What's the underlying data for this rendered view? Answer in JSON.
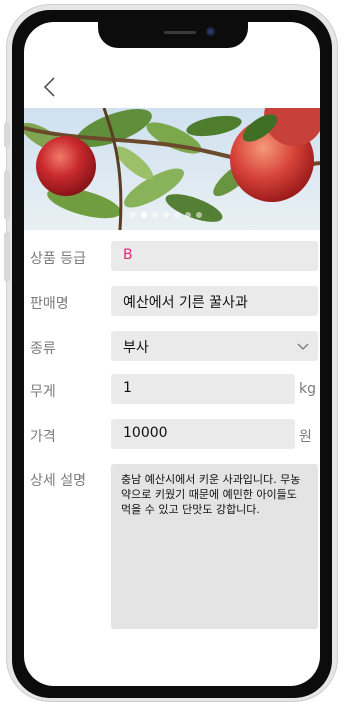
{
  "nav": {
    "back_icon": "chevron-left-icon"
  },
  "hero": {
    "image": "apples-on-tree",
    "dot_count": 7,
    "active_dot": 1
  },
  "form": {
    "grade": {
      "label": "상품 등급",
      "value": "B",
      "value_color": "#e0297a"
    },
    "sale_name": {
      "label": "판매명",
      "value": "예산에서 기른 꿀사과"
    },
    "variety": {
      "label": "종류",
      "value": "부사",
      "icon": "chevron-down-icon"
    },
    "weight": {
      "label": "무게",
      "value": "1",
      "unit": "kg"
    },
    "price": {
      "label": "가격",
      "value": "10000",
      "unit": "원"
    },
    "description": {
      "label": "상세 설명",
      "value": "충남 예산시에서 키운 사과입니다. 무농약으로 키웠기 때문에 예민한 아이들도 먹을 수 있고 단맛도 강합니다."
    }
  }
}
